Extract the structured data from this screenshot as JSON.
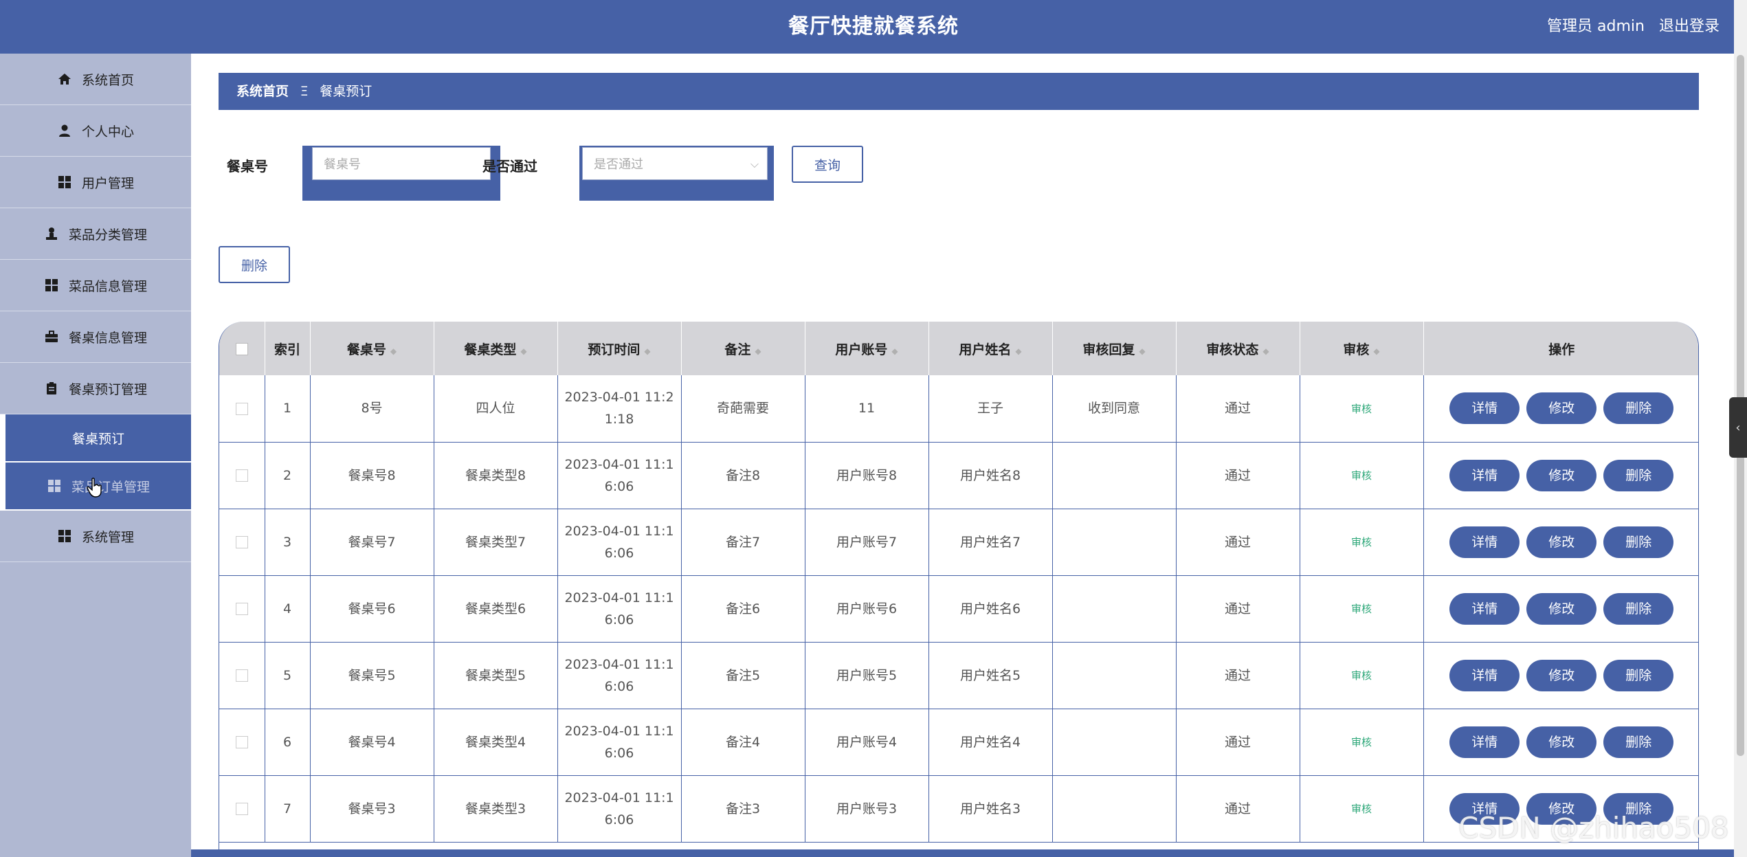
{
  "header": {
    "title": "餐厅快捷就餐系统",
    "user_label": "管理员 admin",
    "logout_label": "退出登录"
  },
  "sidebar": {
    "items": [
      {
        "label": "系统首页",
        "icon": "home-icon"
      },
      {
        "label": "个人中心",
        "icon": "user-icon"
      },
      {
        "label": "用户管理",
        "icon": "grid-icon"
      },
      {
        "label": "菜品分类管理",
        "icon": "person-icon"
      },
      {
        "label": "菜品信息管理",
        "icon": "grid-icon"
      },
      {
        "label": "餐桌信息管理",
        "icon": "briefcase-icon"
      },
      {
        "label": "餐桌预订管理",
        "icon": "clipboard-icon"
      }
    ],
    "sub_items": [
      {
        "label": "餐桌预订"
      },
      {
        "label": "菜品订单管理",
        "icon": "grid-icon"
      }
    ],
    "last_item": {
      "label": "系统管理",
      "icon": "grid-icon"
    }
  },
  "breadcrumb": {
    "home": "系统首页",
    "separator": "Ξ",
    "current": "餐桌预订"
  },
  "search": {
    "table_no_label": "餐桌号",
    "table_no_placeholder": "餐桌号",
    "passed_label": "是否通过",
    "passed_placeholder": "是否通过",
    "query_button": "查询"
  },
  "actions": {
    "delete_button": "删除"
  },
  "table": {
    "columns": [
      "索引",
      "餐桌号",
      "餐桌类型",
      "预订时间",
      "备注",
      "用户账号",
      "用户姓名",
      "审核回复",
      "审核状态",
      "审核",
      "操作"
    ],
    "rows": [
      {
        "index": "1",
        "table_no": "8号",
        "table_type": "四人位",
        "time_a": "2023-04-01 11:2",
        "time_b": "1:18",
        "note": "奇葩需要",
        "account": "11",
        "name": "王子",
        "reply": "收到同意",
        "status": "通过",
        "audit": "审核"
      },
      {
        "index": "2",
        "table_no": "餐桌号8",
        "table_type": "餐桌类型8",
        "time_a": "2023-04-01 11:1",
        "time_b": "6:06",
        "note": "备注8",
        "account": "用户账号8",
        "name": "用户姓名8",
        "reply": "",
        "status": "通过",
        "audit": "审核"
      },
      {
        "index": "3",
        "table_no": "餐桌号7",
        "table_type": "餐桌类型7",
        "time_a": "2023-04-01 11:1",
        "time_b": "6:06",
        "note": "备注7",
        "account": "用户账号7",
        "name": "用户姓名7",
        "reply": "",
        "status": "通过",
        "audit": "审核"
      },
      {
        "index": "4",
        "table_no": "餐桌号6",
        "table_type": "餐桌类型6",
        "time_a": "2023-04-01 11:1",
        "time_b": "6:06",
        "note": "备注6",
        "account": "用户账号6",
        "name": "用户姓名6",
        "reply": "",
        "status": "通过",
        "audit": "审核"
      },
      {
        "index": "5",
        "table_no": "餐桌号5",
        "table_type": "餐桌类型5",
        "time_a": "2023-04-01 11:1",
        "time_b": "6:06",
        "note": "备注5",
        "account": "用户账号5",
        "name": "用户姓名5",
        "reply": "",
        "status": "通过",
        "audit": "审核"
      },
      {
        "index": "6",
        "table_no": "餐桌号4",
        "table_type": "餐桌类型4",
        "time_a": "2023-04-01 11:1",
        "time_b": "6:06",
        "note": "备注4",
        "account": "用户账号4",
        "name": "用户姓名4",
        "reply": "",
        "status": "通过",
        "audit": "审核"
      },
      {
        "index": "7",
        "table_no": "餐桌号3",
        "table_type": "餐桌类型3",
        "time_a": "2023-04-01 11:1",
        "time_b": "6:06",
        "note": "备注3",
        "account": "用户账号3",
        "name": "用户姓名3",
        "reply": "",
        "status": "通过",
        "audit": "审核"
      }
    ],
    "row_buttons": {
      "detail": "详情",
      "edit": "修改",
      "delete": "删除"
    }
  },
  "watermark": "CSDN @zhihao508",
  "colors": {
    "primary": "#4661a6",
    "sidebar": "#b0b8d2",
    "audit_link": "#2fa87a",
    "table_header": "#d4d4d8"
  }
}
